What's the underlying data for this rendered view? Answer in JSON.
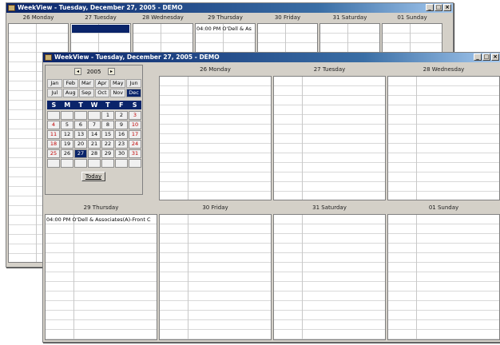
{
  "back_window": {
    "title": "WeekView - Tuesday, December 27, 2005 - DEMO",
    "days": [
      "26 Monday",
      "27 Tuesday",
      "28 Wednesday",
      "29 Thursday",
      "30 Friday",
      "31 Saturday",
      "01 Sunday"
    ],
    "event": "04:00 PM O'Dell & As"
  },
  "front_window": {
    "title": "WeekView - Tuesday, December 27, 2005 - DEMO",
    "days_top": [
      "26 Monday",
      "27 Tuesday",
      "28 Wednesday"
    ],
    "days_bottom": [
      "29 Thursday",
      "30 Friday",
      "31 Saturday",
      "01 Sunday"
    ],
    "event": "04:00 PM O'Dell & Associates(A)-Front C"
  },
  "calendar": {
    "year": "2005",
    "months": [
      "Jan",
      "Feb",
      "Mar",
      "Apr",
      "May",
      "Jun",
      "Jul",
      "Aug",
      "Sep",
      "Oct",
      "Nov",
      "Dec"
    ],
    "selected_month": "Dec",
    "weekdays": [
      "S",
      "M",
      "T",
      "W",
      "T",
      "F",
      "S"
    ],
    "days": [
      "",
      "",
      "",
      "",
      "1",
      "2",
      "3",
      "4",
      "5",
      "6",
      "7",
      "8",
      "9",
      "10",
      "11",
      "12",
      "13",
      "14",
      "15",
      "16",
      "17",
      "18",
      "19",
      "20",
      "21",
      "22",
      "23",
      "24",
      "25",
      "26",
      "27",
      "28",
      "29",
      "30",
      "31",
      "",
      "",
      "",
      "",
      "",
      "",
      ""
    ],
    "selected_day": "27",
    "today_label": "Today"
  },
  "colors": {
    "title_bar": "#0a246a",
    "selected": "#0a246a",
    "weekend_text": "#c00000",
    "window_bg": "#d4d0c8"
  }
}
